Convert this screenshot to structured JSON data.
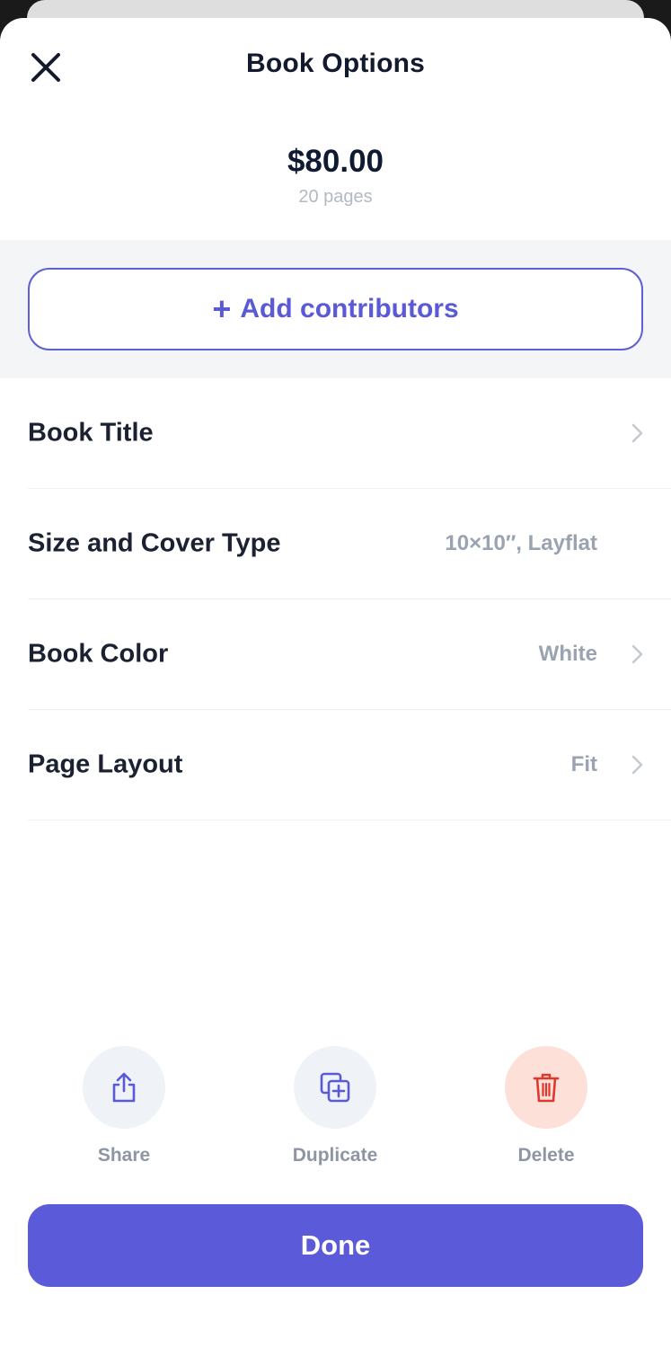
{
  "header": {
    "title": "Book Options",
    "close_icon": "close-icon"
  },
  "summary": {
    "price": "$80.00",
    "pages": "20 pages"
  },
  "contributors": {
    "plus": "+",
    "label": "Add contributors"
  },
  "options": [
    {
      "label": "Book Title",
      "value": "",
      "chevron": true
    },
    {
      "label": "Size and Cover Type",
      "value": "10×10″, Layflat",
      "chevron": false
    },
    {
      "label": "Book Color",
      "value": "White",
      "chevron": true
    },
    {
      "label": "Page Layout",
      "value": "Fit",
      "chevron": true
    }
  ],
  "actions": {
    "share": {
      "label": "Share",
      "icon": "share-icon"
    },
    "duplicate": {
      "label": "Duplicate",
      "icon": "duplicate-icon"
    },
    "delete": {
      "label": "Delete",
      "icon": "trash-icon"
    }
  },
  "done": {
    "label": "Done"
  },
  "colors": {
    "accent": "#5b5bd9",
    "title": "#141a2e",
    "muted": "#9aa3b0",
    "delete_red": "#e0382f",
    "delete_bg": "#fde0d8"
  }
}
